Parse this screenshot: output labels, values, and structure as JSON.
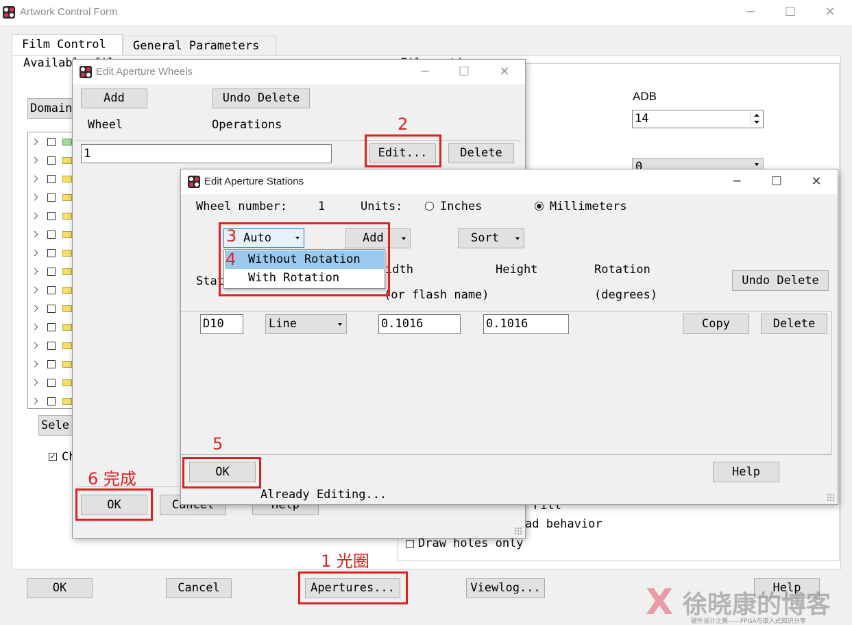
{
  "main_window": {
    "title": "Artwork Control Form",
    "tabs": [
      {
        "label": "Film Control"
      },
      {
        "label": "General Parameters"
      }
    ],
    "available_films_label": "Available fil",
    "film_options_label": "Film opti",
    "domain_button": "Domain",
    "select_button": "Sele",
    "check_label": "Ch",
    "adb_label": "ADB",
    "adb_value": "14",
    "combo_value": "0",
    "fill_label": "Fill",
    "pad_behavior_label": "ad behavior",
    "draw_holes_label": "Draw holes only",
    "buttons": {
      "ok": "OK",
      "cancel": "Cancel",
      "apertures": "Apertures...",
      "viewlog": "Viewlog...",
      "help": "Help"
    }
  },
  "wheels_dialog": {
    "title": "Edit Aperture Wheels",
    "add_button": "Add",
    "undo_delete_button": "Undo Delete",
    "col_wheel": "Wheel",
    "col_operations": "Operations",
    "row_value": "1",
    "edit_button": "Edit...",
    "delete_button": "Delete",
    "ok_button": "OK",
    "cancel_button": "Cancel",
    "help_button": "Help"
  },
  "stations_dialog": {
    "title": "Edit Aperture Stations",
    "wheel_number_label": "Wheel number:",
    "wheel_number_value": "1",
    "units_label": "Units:",
    "inches_label": "Inches",
    "mm_label": "Millimeters",
    "units_selected": "Millimeters",
    "auto_combo": "Auto",
    "dropdown_options": [
      "Without Rotation",
      "With Rotation"
    ],
    "add_button": "Add",
    "sort_button": "Sort",
    "col_station": "Stat",
    "col_width": "idth",
    "col_width_sub": "(or flash name)",
    "col_height": "Height",
    "col_rotation": "Rotation",
    "col_rotation_sub": "(degrees)",
    "undo_delete_button": "Undo Delete",
    "row": {
      "station": "D10",
      "shape": "Line",
      "width": "0.1016",
      "height": "0.1016"
    },
    "copy_button": "Copy",
    "delete_button": "Delete",
    "ok_button": "OK",
    "help_button": "Help",
    "status": "Already Editing..."
  },
  "annotations": {
    "step1": "1 光圈",
    "step2": "2",
    "step3": "3",
    "step4": "4",
    "step5": "5",
    "step6": "6 完成"
  },
  "watermark": {
    "text": "徐晓康的博客",
    "sub": "硬件设计之美——FPGA与嵌入式知识分享"
  },
  "colors": {
    "annotation_red": "#e02020",
    "selection_blue": "#99c9ef"
  }
}
